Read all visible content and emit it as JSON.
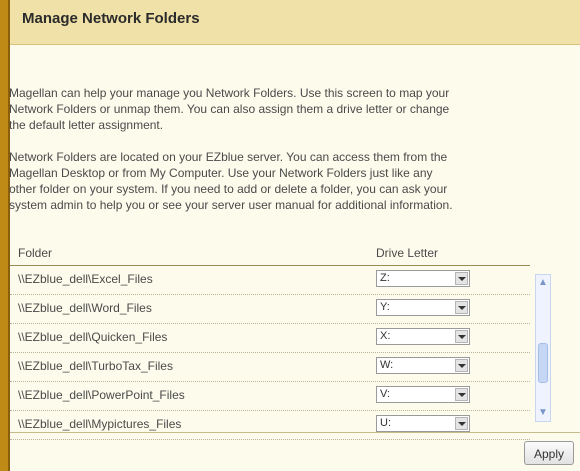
{
  "header": {
    "title": "Manage Network Folders"
  },
  "intro": {
    "lines": [
      "Magellan can help your manage you Network Folders. Use this screen to map your",
      "Network Folders or unmap them. You can also assign them a drive letter or change",
      "the default letter assignment."
    ]
  },
  "info": {
    "lines": [
      "Network Folders are located on your EZblue server. You can access them from the",
      "Magellan Desktop or from My Computer. Use your Network Folders just like any",
      "other folder on your system. If you need to add or delete a folder, you can ask your",
      "system admin to help you or see your server user manual for additional information."
    ]
  },
  "table": {
    "columns": {
      "folder": "Folder",
      "drive": "Drive Letter"
    },
    "rows": [
      {
        "folder": "\\\\EZblue_dell\\Excel_Files",
        "drive": "Z:"
      },
      {
        "folder": "\\\\EZblue_dell\\Word_Files",
        "drive": "Y:"
      },
      {
        "folder": "\\\\EZblue_dell\\Quicken_Files",
        "drive": "X:"
      },
      {
        "folder": "\\\\EZblue_dell\\TurboTax_Files",
        "drive": "W:"
      },
      {
        "folder": "\\\\EZblue_dell\\PowerPoint_Files",
        "drive": "V:"
      },
      {
        "folder": "\\\\EZblue_dell\\Mypictures_Files",
        "drive": "U:"
      }
    ]
  },
  "scrollbar": {
    "up_icon": "chevron-up-icon",
    "down_icon": "chevron-down-icon"
  },
  "actions": {
    "apply_label": "Apply"
  },
  "colors": {
    "frame": "#c08a16",
    "header_bg": "#f0e1a8",
    "panel_bg": "#fdfbec"
  }
}
